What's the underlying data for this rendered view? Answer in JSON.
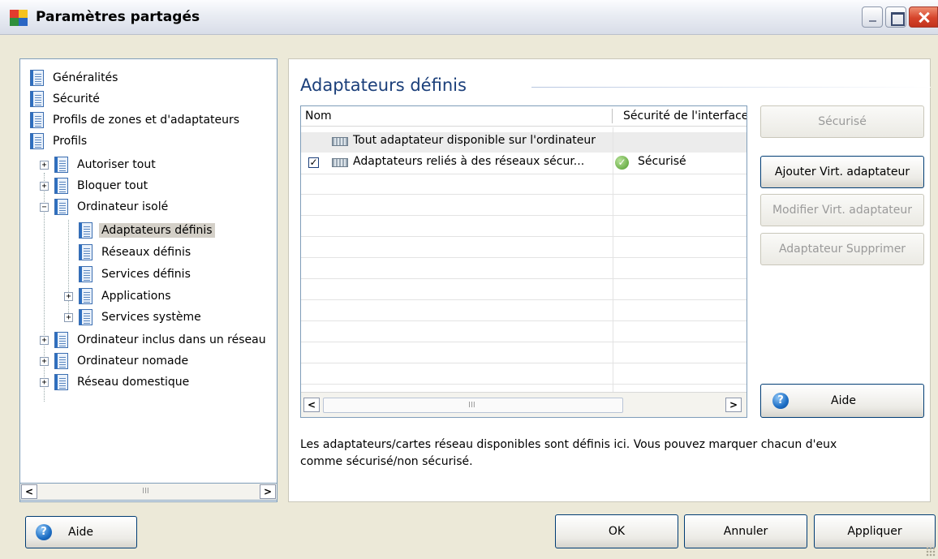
{
  "window": {
    "title": "Paramètres partagés",
    "app_icon": "avg-app-icon",
    "controls": {
      "minimize": "minimize-icon",
      "maximize": "maximize-icon",
      "close": "close-icon"
    }
  },
  "tree": {
    "items": [
      {
        "label": "Généralités",
        "level": 0,
        "expander": ""
      },
      {
        "label": "Sécurité",
        "level": 0,
        "expander": ""
      },
      {
        "label": "Profils de zones et d'adaptateurs",
        "level": 0,
        "expander": ""
      },
      {
        "label": "Profils",
        "level": 0,
        "expander": ""
      },
      {
        "label": "Autoriser tout",
        "level": 1,
        "expander": "+"
      },
      {
        "label": "Bloquer tout",
        "level": 1,
        "expander": "+"
      },
      {
        "label": "Ordinateur isolé",
        "level": 1,
        "expander": "−"
      },
      {
        "label": "Adaptateurs définis",
        "level": 2,
        "expander": "",
        "selected": true
      },
      {
        "label": "Réseaux définis",
        "level": 2,
        "expander": ""
      },
      {
        "label": "Services définis",
        "level": 2,
        "expander": ""
      },
      {
        "label": "Applications",
        "level": 2,
        "expander": "+"
      },
      {
        "label": "Services système",
        "level": 2,
        "expander": "+"
      },
      {
        "label": "Ordinateur inclus dans un réseau",
        "level": 1,
        "expander": "+"
      },
      {
        "label": "Ordinateur nomade",
        "level": 1,
        "expander": "+"
      },
      {
        "label": "Réseau domestique",
        "level": 1,
        "expander": "+"
      }
    ],
    "scroll_left": "<",
    "scroll_right": ">",
    "scroll_grip": "III"
  },
  "main": {
    "section_title": "Adaptateurs définis",
    "table": {
      "columns": [
        "Nom",
        "Sécurité de l'interface"
      ],
      "rows": [
        {
          "checkbox": false,
          "name": "Tout adaptateur disponible sur l'ordinateur",
          "status": "",
          "icon": "network-adapter-icon"
        },
        {
          "checkbox": true,
          "check_mark": "☑",
          "name": "Adaptateurs reliés à des réseaux sécur...",
          "status": "Sécurisé",
          "status_icon": "green-check-icon",
          "icon": "network-adapter-icon"
        }
      ],
      "scroll_left": "<",
      "scroll_right": ">",
      "scroll_grip": "III"
    },
    "buttons": {
      "secure": "Sécurisé",
      "add_virtual": "Ajouter Virt. adaptateur",
      "modify_virtual": "Modifier Virt. adaptateur",
      "delete_adapter": "Adaptateur Supprimer",
      "help": "Aide"
    },
    "description": "Les adaptateurs/cartes réseau disponibles sont définis ici. Vous pouvez marquer chacun d'eux comme sécurisé/non sécurisé."
  },
  "footer": {
    "help": "Aide",
    "ok": "OK",
    "cancel": "Annuler",
    "apply": "Appliquer"
  },
  "colors": {
    "title_blue": "#1b3f7a",
    "dialog_bg": "#ece9d8",
    "border_blue": "#7f9db9",
    "close_red": "#d6442b"
  }
}
